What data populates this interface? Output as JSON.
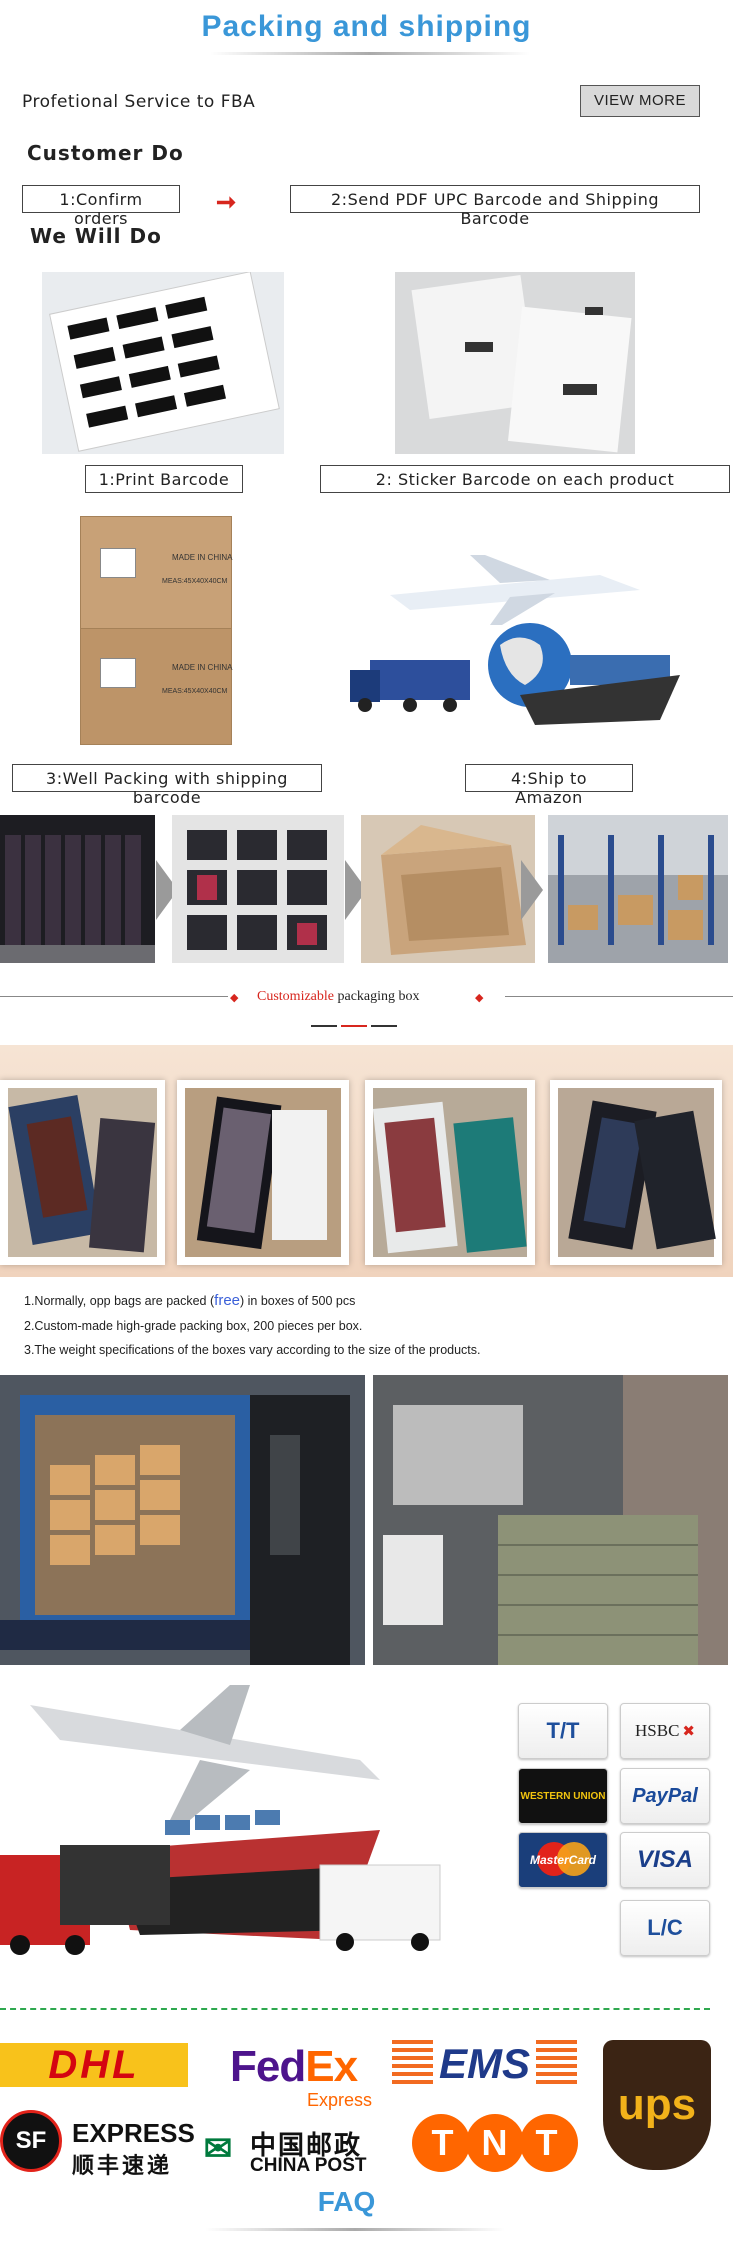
{
  "header": {
    "title": "Packing and shipping"
  },
  "fba": {
    "text": "Profetional Service to FBA",
    "view_more": "VIEW MORE"
  },
  "customer": {
    "heading": "Customer Do",
    "step1": "1:Confirm orders",
    "step2": "2:Send PDF UPC Barcode and Shipping Barcode"
  },
  "we": {
    "heading": "We Will Do",
    "step1": "1:Print Barcode",
    "step2": "2:   Sticker Barcode on each product",
    "step3": "3:Well Packing with shipping barcode",
    "step4": "4:Ship to Amazon",
    "box_label_1": "MADE IN CHINA",
    "box_label_2": "MEAS:45X40X40CM"
  },
  "packaging": {
    "word1": "Customizable",
    "word2": " packaging box"
  },
  "notes": {
    "line1_pre": "1.Normally, opp bags are packed (",
    "line1_free": "free",
    "line1_post": ") in boxes of 500 pcs",
    "line2": "2.Custom-made high-grade packing box, 200 pieces per box.",
    "line3": "3.The weight specifications of the boxes vary according to the size of the products."
  },
  "payments": {
    "tt": "T/T",
    "hsbc": "HSBC",
    "western": "WESTERN UNION",
    "paypal": "PayPal",
    "mastercard": "MasterCard",
    "visa": "VISA",
    "lc": "L/C"
  },
  "carriers": {
    "dhl": "DHL",
    "fedex_fed": "Fed",
    "fedex_ex": "Ex",
    "fedex_express": "Express",
    "ems": "EMS",
    "ups": "ups",
    "sf_mark": "SF",
    "sf_express": "EXPRESS",
    "sf_cn": "顺丰速递",
    "chinapost_cn": "中国邮政",
    "chinapost_en": "CHINA POST",
    "tnt": "TNT"
  },
  "footer": {
    "faq": "FAQ"
  },
  "colors": {
    "title_blue": "#3a97d8",
    "accent_red": "#d7261e",
    "dashed_green": "#2ea84f"
  }
}
